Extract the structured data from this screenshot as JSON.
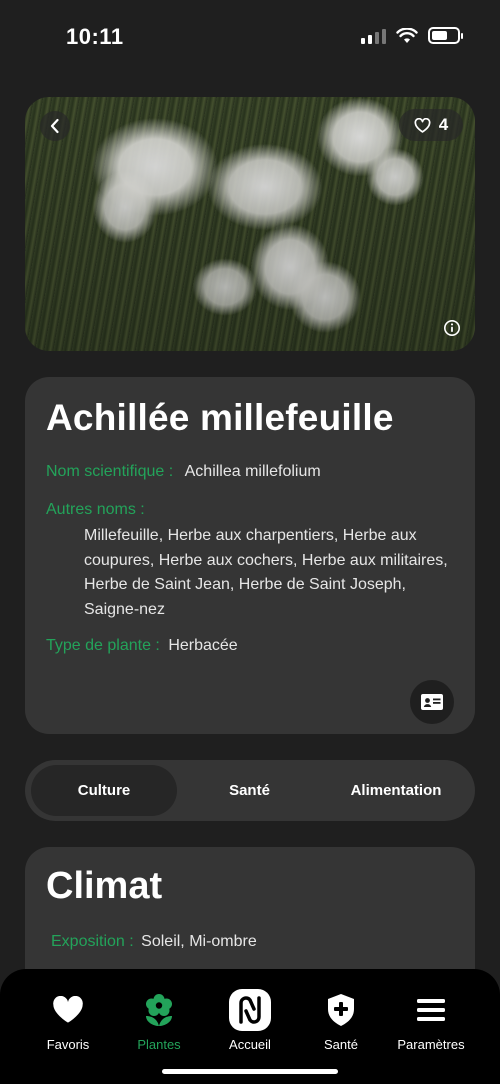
{
  "status_bar": {
    "time": "10:11"
  },
  "hero": {
    "likes": "4",
    "icons": [
      "chevron-left-icon",
      "heart-icon",
      "info-icon"
    ]
  },
  "plant": {
    "name": "Achillée millefeuille",
    "scientific_label": "Nom scientifique :",
    "scientific_value": "Achillea millefolium",
    "other_names_label": "Autres noms :",
    "other_names_value": "Millefeuille, Herbe aux charpentiers, Herbe aux coupures, Herbe aux cochers, Herbe aux militaires, Herbe de Saint Jean, Herbe de Saint Joseph, Saigne-nez",
    "type_label": "Type de plante :",
    "type_value": "Herbacée"
  },
  "tabs": [
    {
      "label": "Culture",
      "active": true
    },
    {
      "label": "Santé",
      "active": false
    },
    {
      "label": "Alimentation",
      "active": false
    }
  ],
  "climat": {
    "title": "Climat",
    "exposition_label": "Exposition :",
    "exposition_value": "Soleil, Mi-ombre"
  },
  "nav": {
    "items": [
      {
        "label": "Favoris",
        "icon": "heart-icon"
      },
      {
        "label": "Plantes",
        "icon": "flower-icon",
        "active": true
      },
      {
        "label": "Accueil",
        "icon": "logo-icon"
      },
      {
        "label": "Santé",
        "icon": "shield-plus-icon"
      },
      {
        "label": "Paramètres",
        "icon": "menu-icon"
      }
    ]
  },
  "colors": {
    "accent": "#23a35a",
    "background": "#1f1f1f",
    "card": "#353535",
    "nav": "#000000"
  }
}
